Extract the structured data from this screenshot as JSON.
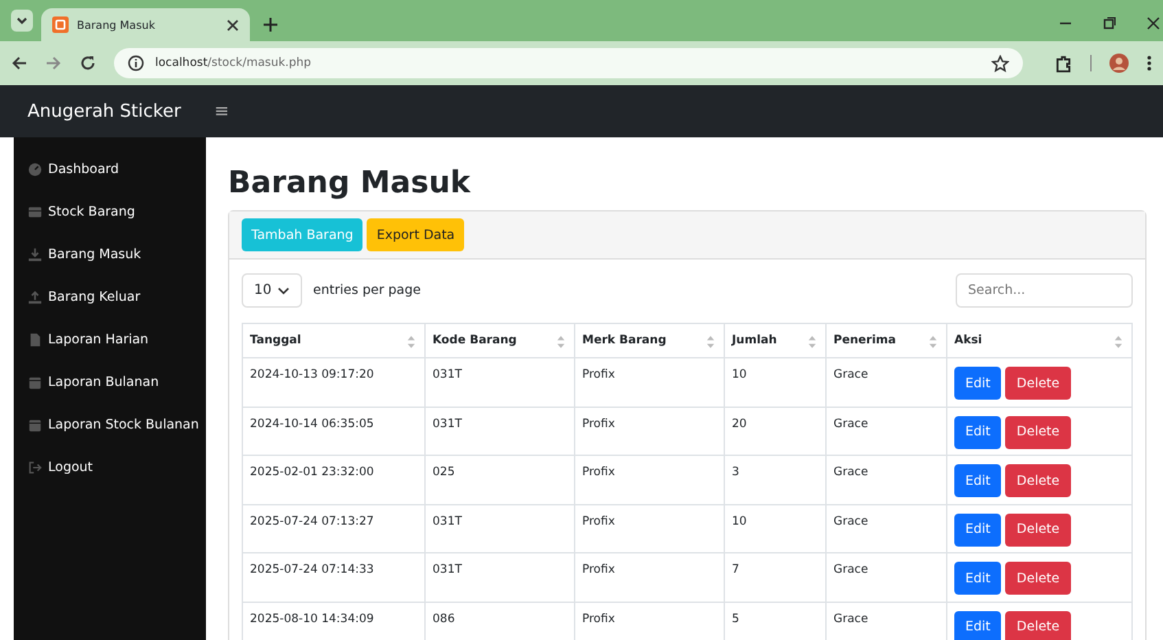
{
  "browser": {
    "tab_title": "Barang Masuk",
    "url_host": "localhost",
    "url_path": "/stock/masuk.php"
  },
  "navbar": {
    "brand": "Anugerah Sticker",
    "menu_icon": "≡"
  },
  "sidebar": {
    "items": [
      {
        "label": "Dashboard"
      },
      {
        "label": "Stock Barang"
      },
      {
        "label": "Barang Masuk"
      },
      {
        "label": "Barang Keluar"
      },
      {
        "label": "Laporan Harian"
      },
      {
        "label": "Laporan Bulanan"
      },
      {
        "label": "Laporan Stock Bulanan"
      },
      {
        "label": "Logout"
      }
    ]
  },
  "page_title": "Barang Masuk",
  "toolbar": [
    {
      "label": "Tambah Barang",
      "kind": "info"
    },
    {
      "label": "Export Data",
      "kind": "warning"
    }
  ],
  "entries": {
    "value": "10",
    "label": "entries per page"
  },
  "search": {
    "placeholder": "Search..."
  },
  "table": {
    "columns": [
      "Tanggal",
      "Kode Barang",
      "Merk Barang",
      "Jumlah",
      "Penerima",
      "Aksi"
    ],
    "rows": [
      {
        "cells": [
          "2024-10-13 09:17:20",
          "031T",
          "Profix",
          "10",
          "Grace"
        ],
        "actions": [
          "Edit",
          "Delete"
        ]
      },
      {
        "cells": [
          "2024-10-14 06:35:05",
          "031T",
          "Profix",
          "20",
          "Grace"
        ],
        "actions": [
          "Edit",
          "Delete"
        ]
      },
      {
        "cells": [
          "2025-02-01 23:32:00",
          "025",
          "Profix",
          "3",
          "Grace"
        ],
        "actions": [
          "Edit",
          "Delete"
        ]
      },
      {
        "cells": [
          "2025-07-24 07:13:27",
          "031T",
          "Profix",
          "10",
          "Grace"
        ],
        "actions": [
          "Edit",
          "Delete"
        ]
      },
      {
        "cells": [
          "2025-07-24 07:14:33",
          "031T",
          "Profix",
          "7",
          "Grace"
        ],
        "actions": [
          "Edit",
          "Delete"
        ]
      },
      {
        "cells": [
          "2025-08-10 14:34:09",
          "086",
          "Profix",
          "5",
          "Grace"
        ],
        "actions": [
          "Edit",
          "Delete"
        ]
      }
    ]
  }
}
